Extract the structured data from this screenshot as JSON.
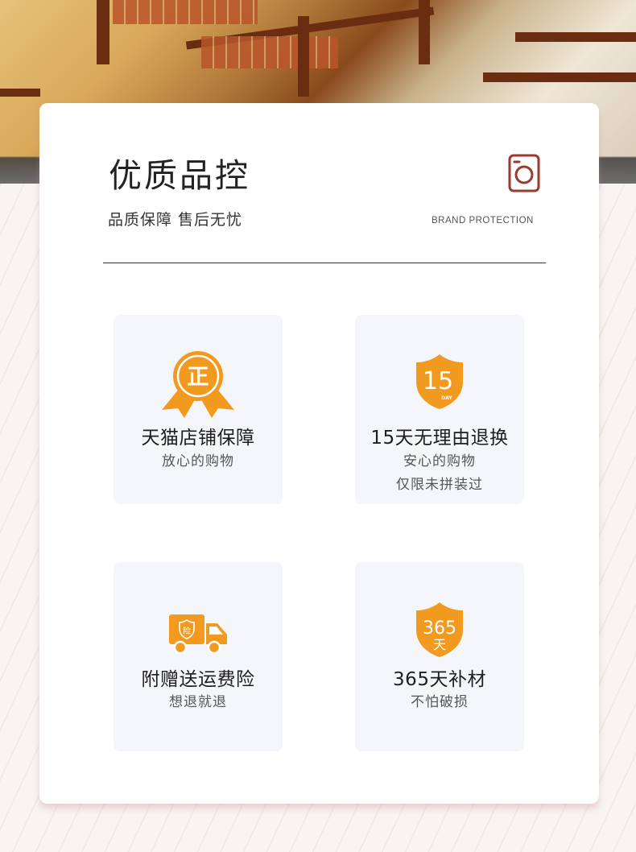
{
  "header": {
    "title": "优质品控",
    "subtitle": "品质保障 售后无忧",
    "brand_en": "BRAND PROTECTION"
  },
  "colors": {
    "accent_orange": "#f29a1f",
    "accent_orange_dark": "#e9790c",
    "camera_icon": "#9b3a2f"
  },
  "features": [
    {
      "icon": "genuine-badge-icon",
      "icon_text": "正",
      "title": "天猫店铺保障",
      "lines": [
        "放心的购物"
      ]
    },
    {
      "icon": "shield-15-day-icon",
      "icon_text": "15",
      "icon_subtext": "DAY",
      "title": "15天无理由退换",
      "lines": [
        "安心的购物",
        "仅限未拼装过"
      ]
    },
    {
      "icon": "shipping-truck-icon",
      "icon_text": "险",
      "title": "附赠送运费险",
      "lines": [
        "想退就退"
      ]
    },
    {
      "icon": "shield-365-day-icon",
      "icon_text": "365",
      "icon_subtext": "天",
      "title": "365天补材",
      "lines": [
        "不怕破损"
      ]
    }
  ]
}
